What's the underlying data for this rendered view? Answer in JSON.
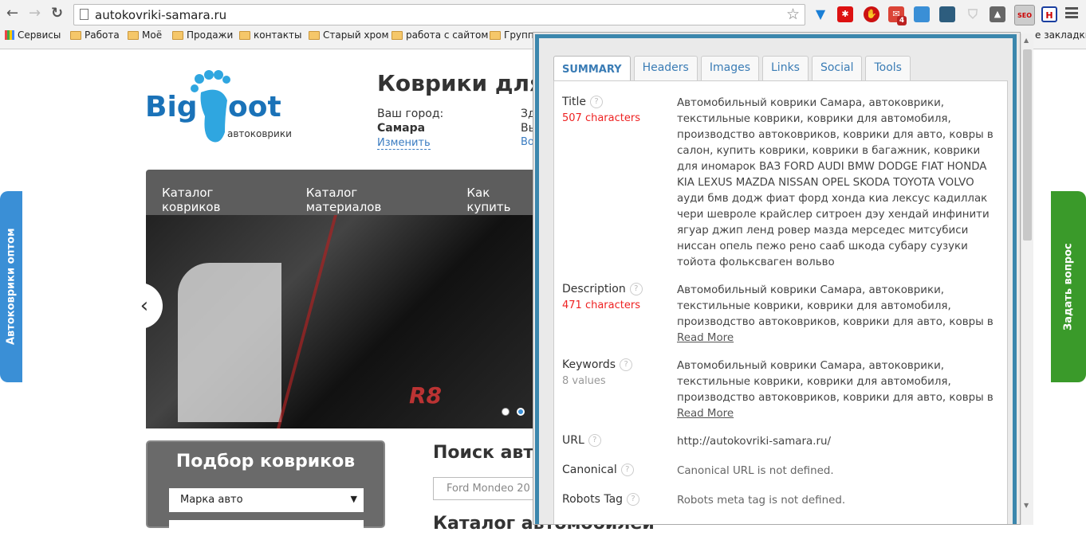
{
  "browser": {
    "url": "autokovriki-samara.ru",
    "bookmarks": [
      "Сервисы",
      "Работа",
      "Моё",
      "Продажи",
      "контакты",
      "Старый хром",
      "работа с сайтом",
      "Групп"
    ],
    "other_bookmarks": "е закладки",
    "extensions": [
      "yandex",
      "lastpass",
      "adblock",
      "gmail",
      "window-tab",
      "layers",
      "shield",
      "drive",
      "seo",
      "h"
    ],
    "gmail_badge": "4",
    "seo_icon": "SEO"
  },
  "site": {
    "logo_text": "BigFoot",
    "logo_sub": "автоковрики",
    "heading": "Коврики для а",
    "city_label": "Ваш город:",
    "city": "Самара",
    "change_link": "Изменить",
    "col2": [
      "Зд",
      "Вы",
      "Во"
    ],
    "menu": [
      "Каталог ковриков",
      "Каталог материалов",
      "Как купить"
    ],
    "slider_text": "R8",
    "side_left": "Автоковрики оптом",
    "side_right": "Задать вопрос",
    "podbor_title": "Подбор ковриков",
    "brand_select": "Марка авто",
    "search_title": "Поиск авто",
    "search_placeholder": "Ford Mondeo 20",
    "catalog_title": "Каталог автомобилей"
  },
  "seo": {
    "tabs": [
      "SUMMARY",
      "Headers",
      "Images",
      "Links",
      "Social",
      "Tools"
    ],
    "title": {
      "label": "Title",
      "sub": "507 characters",
      "value": "Автомобильный коврики Самара, автоковрики, текстильные коврики, коврики для автомобиля, производство автоковриков, коврики для авто, ковры в салон, купить коврики, коврики в багажник, коврики для иномарок ВАЗ FORD AUDI BMW DODGE FIAT HONDA KIA LEXUS MAZDA NISSAN OPEL SKODA TOYOTA VOLVO ауди бмв додж фиат форд хонда киа лексус кадиллак чери шевроле крайслер ситроен дэу хендай инфинити ягуар джип ленд ровер мазда мерседес митсубиси ниссан опель пежо рено сааб шкода субару сузуки тойота фольксваген вольво"
    },
    "description": {
      "label": "Description",
      "sub": "471 characters",
      "value": "Автомобильный коврики Самара, автоковрики, текстильные коврики, коврики для автомобиля, производство автоковриков, коврики для авто, ковры в",
      "more": "Read More"
    },
    "keywords": {
      "label": "Keywords",
      "sub": "8 values",
      "value": "Автомобильный коврики Самара, автоковрики, текстильные коврики, коврики для автомобиля, производство автоковриков, коврики для авто, ковры в",
      "more": "Read More"
    },
    "url": {
      "label": "URL",
      "value": "http://autokovriki-samara.ru/"
    },
    "canonical": {
      "label": "Canonical",
      "value": "Canonical URL is not defined."
    },
    "robots": {
      "label": "Robots Tag",
      "value": "Robots meta tag is not defined."
    },
    "help": "?"
  }
}
